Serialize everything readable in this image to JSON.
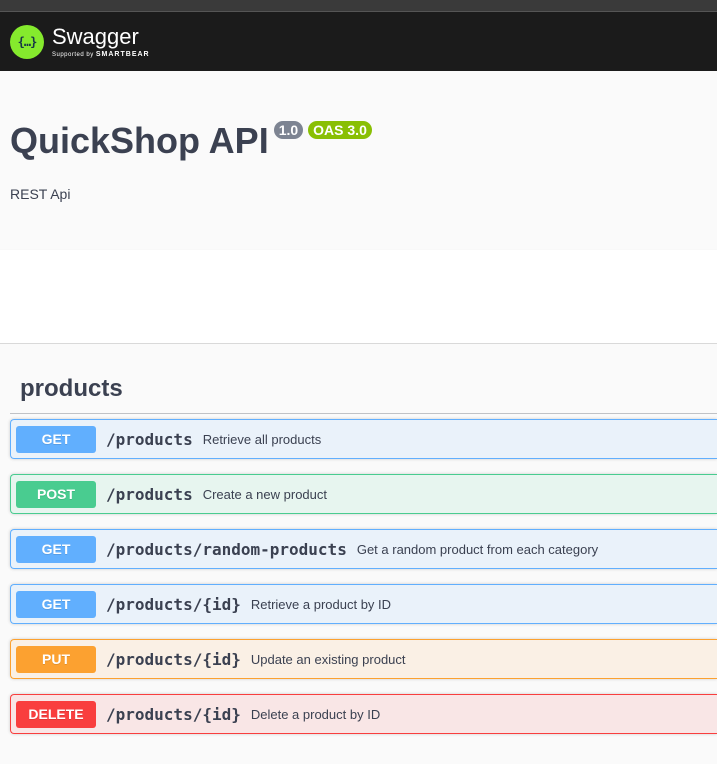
{
  "topbar": {
    "logo_icon": "{…}",
    "logo_title": "Swagger",
    "logo_sub_prefix": "Supported by",
    "logo_sub_brand": "SMARTBEAR"
  },
  "info": {
    "title": "QuickShop API",
    "version_badge": "1.0",
    "oas_badge": "OAS 3.0",
    "description": "REST Api"
  },
  "tag": {
    "name": "products"
  },
  "operations": [
    {
      "method": "GET",
      "path": "/products",
      "summary": "Retrieve all products"
    },
    {
      "method": "POST",
      "path": "/products",
      "summary": "Create a new product"
    },
    {
      "method": "GET",
      "path": "/products/random-products",
      "summary": "Get a random product from each category"
    },
    {
      "method": "GET",
      "path": "/products/{id}",
      "summary": "Retrieve a product by ID"
    },
    {
      "method": "PUT",
      "path": "/products/{id}",
      "summary": "Update an existing product"
    },
    {
      "method": "DELETE",
      "path": "/products/{id}",
      "summary": "Delete a product by ID"
    }
  ],
  "colors": {
    "get": "#61affe",
    "post": "#49cc90",
    "put": "#fca130",
    "delete": "#f93e3e",
    "swagger_green": "#85ea2d",
    "text": "#3b4151"
  }
}
